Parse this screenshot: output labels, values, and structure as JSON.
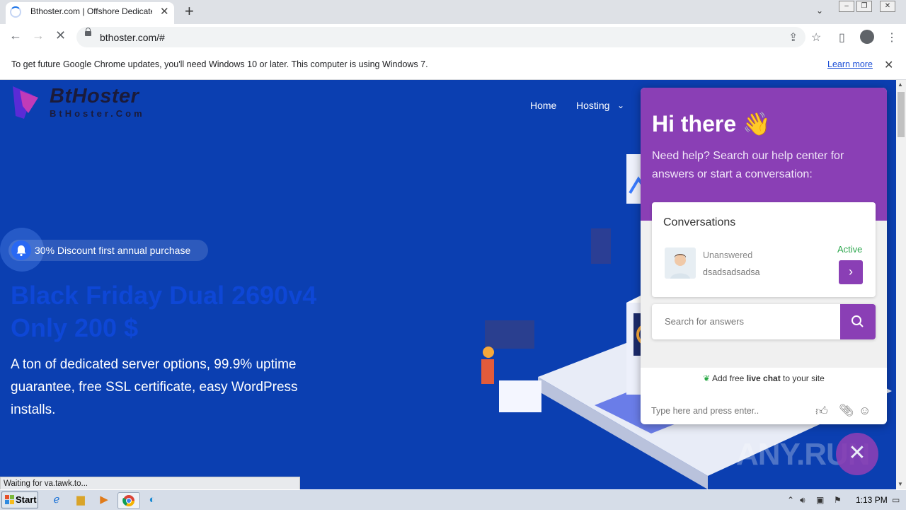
{
  "browser": {
    "tab_title": "Bthoster.com | Offshore Dedicated S",
    "url": "bthoster.com/#",
    "infobar_text": "To get future Google Chrome updates, you'll need Windows 10 or later. This computer is using Windows 7.",
    "infobar_link": "Learn more",
    "status_text": "Waiting for va.tawk.to..."
  },
  "site": {
    "logo_name": "BtHoster",
    "logo_sub": "BtHoster.Com",
    "nav": {
      "home": "Home",
      "hosting": "Hosting"
    },
    "badge_text": "30% Discount first annual purchase",
    "headline_line1": "Black Friday Dual 2690v4",
    "headline_line2": "Only 200 $",
    "subtext": "A ton of dedicated server options, 99.9% uptime guarantee, free SSL certificate, easy WordPress installs."
  },
  "chat": {
    "title": "Hi there 👋",
    "description": "Need help? Search our help center for answers or start a conversation:",
    "conversations_title": "Conversations",
    "conversation": {
      "status": "Unanswered",
      "message": "dsadsadsadsa",
      "state": "Active"
    },
    "search_placeholder": "Search for answers",
    "powered_prefix": "Add free ",
    "powered_bold": "live chat",
    "powered_suffix": " to your site",
    "input_placeholder": "Type here and press enter.."
  },
  "watermark": "ANY.RUN",
  "taskbar": {
    "start_label": "Start",
    "clock": "1:13 PM"
  },
  "colors": {
    "page_bg": "#0b3fb1",
    "chat_accent": "#8a3fb5",
    "active_green": "#2fa84f",
    "headline": "#0e47d6"
  }
}
